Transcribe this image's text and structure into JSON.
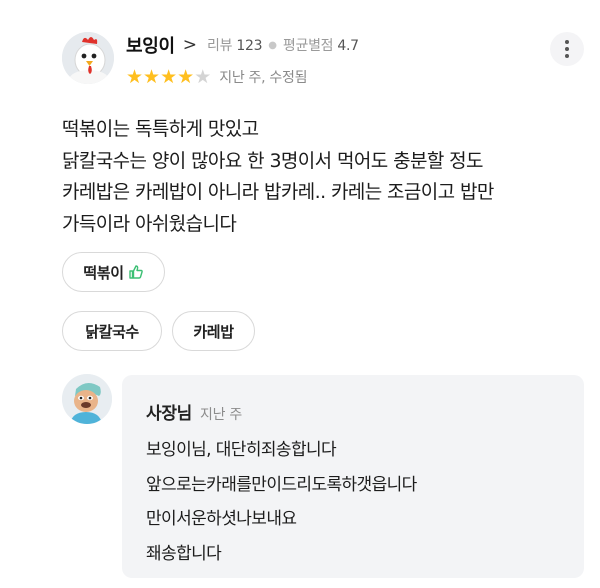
{
  "review": {
    "nickname": "보잉이",
    "chevron": ">",
    "review_label": "리뷰",
    "review_count": "123",
    "avg_label": "평균별점",
    "avg_rating": "4.7",
    "rating": 4,
    "rating_max": 5,
    "date": "지난 주, 수정됨",
    "body_lines": [
      "떡볶이는 독특하게 맛있고",
      "닭칼국수는 양이 많아요 한 3명이서 먹어도 충분할 정도",
      "카레밥은 카레밥이 아니라 밥카레.. 카레는 조금이고 밥만",
      "가득이라 아쉬웠습니다"
    ],
    "menu_tags": [
      {
        "label": "떡볶이",
        "liked": true
      },
      {
        "label": "닭칼국수",
        "liked": false
      },
      {
        "label": "카레밥",
        "liked": false
      }
    ]
  },
  "reply": {
    "owner_label": "사장님",
    "date": "지난 주",
    "body_lines": [
      "보잉이님, 대단히죄송합니다",
      "앞으로는카래를만이드리도록하갯읍니다",
      "만이서운하셧나보내요",
      "좨송합니다"
    ]
  },
  "colors": {
    "star": "#ffbf1f",
    "star_off": "#d4d4d4",
    "thumb": "#3bbf73",
    "reply_bg": "#f3f4f6"
  },
  "icons": {
    "reviewer_avatar": "chicken-avatar-icon",
    "owner_avatar": "owner-avatar-icon",
    "more": "more-vertical-icon",
    "like": "thumbs-up-icon",
    "star": "star-icon"
  }
}
